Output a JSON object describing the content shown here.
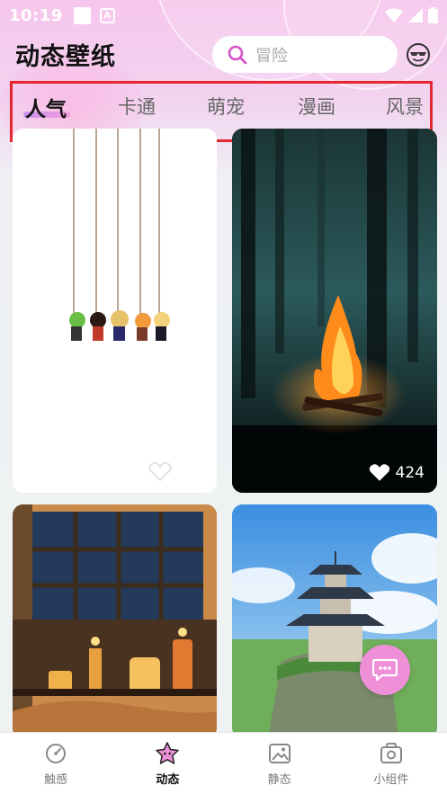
{
  "status_bar": {
    "time": "10:19",
    "app_badge": "A"
  },
  "header": {
    "title": "动态壁纸",
    "search_placeholder": "冒险"
  },
  "tabs": [
    {
      "label": "人气",
      "active": true
    },
    {
      "label": "卡通",
      "active": false
    },
    {
      "label": "萌宠",
      "active": false
    },
    {
      "label": "漫画",
      "active": false
    },
    {
      "label": "风景",
      "active": false
    }
  ],
  "cards": [
    {
      "subject": "hanging-cartoon-characters",
      "liked": false
    },
    {
      "subject": "forest-campfire",
      "likes": "424"
    },
    {
      "subject": "candles-window-cat"
    },
    {
      "subject": "pagoda-on-cliff"
    }
  ],
  "bottom_nav": [
    {
      "label": "触感",
      "icon": "gauge-icon"
    },
    {
      "label": "动态",
      "icon": "star-face-icon",
      "active": true
    },
    {
      "label": "静态",
      "icon": "image-icon"
    },
    {
      "label": "小组件",
      "icon": "widget-icon"
    }
  ],
  "colors": {
    "accent": "#ef8fd8",
    "tab_highlight": "#e8262e",
    "search_icon": "#d455c8"
  }
}
